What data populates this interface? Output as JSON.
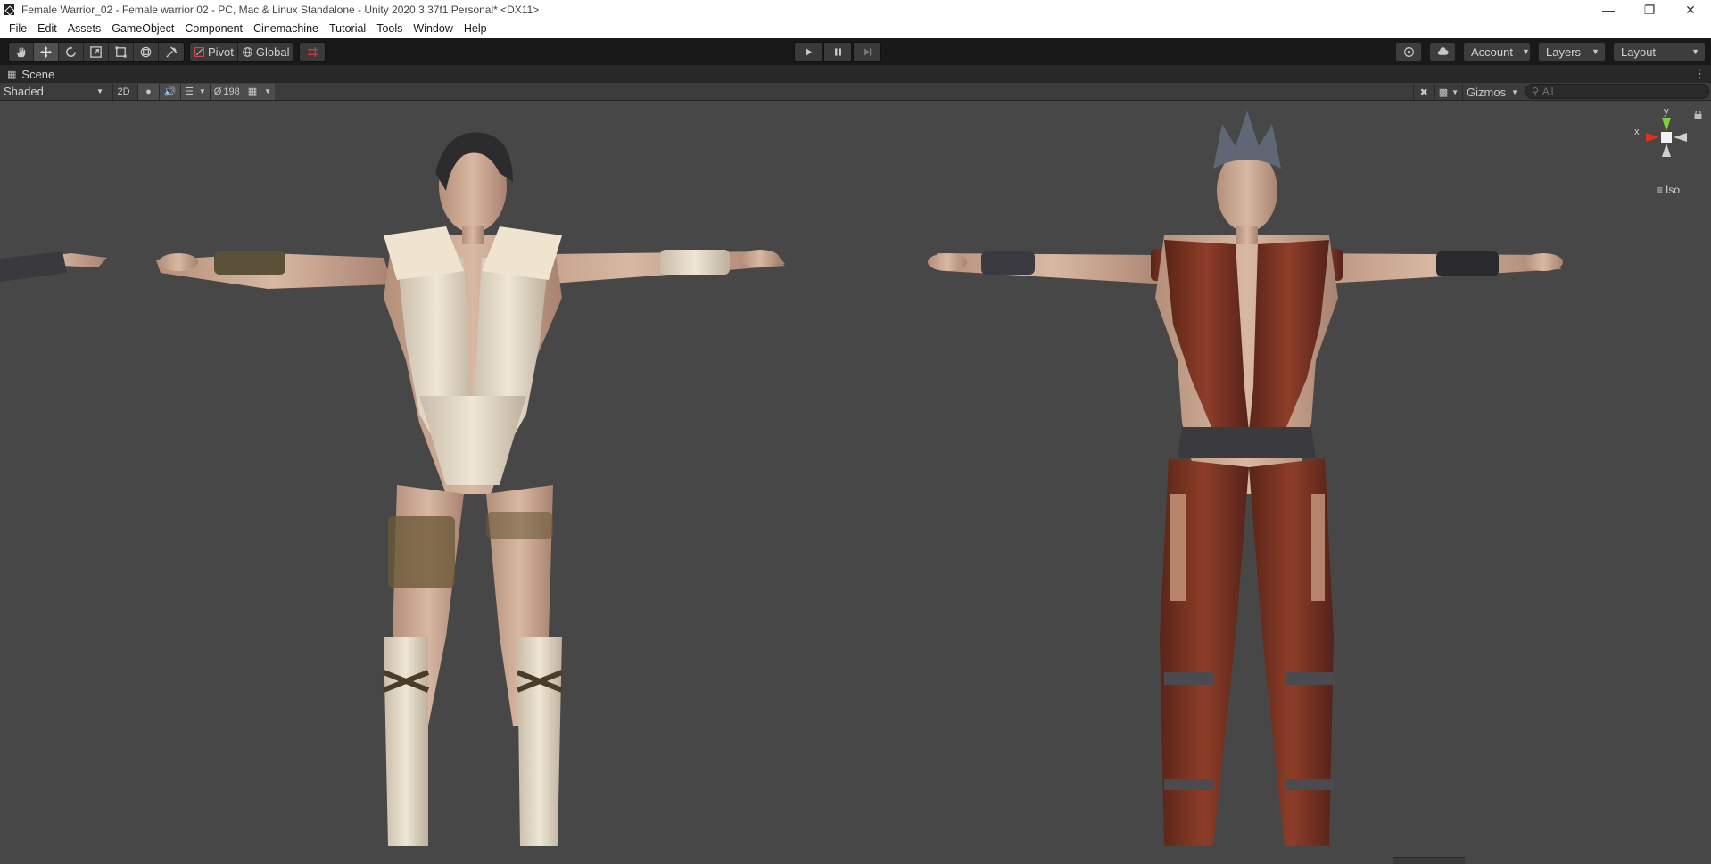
{
  "window": {
    "title": "Female Warrior_02 - Female warrior 02 - PC, Mac & Linux Standalone - Unity 2020.3.37f1 Personal* <DX11>",
    "controls": [
      "minimize-icon",
      "restore-icon",
      "close-icon"
    ]
  },
  "menu": [
    "File",
    "Edit",
    "Assets",
    "GameObject",
    "Component",
    "Cinemachine",
    "Tutorial",
    "Tools",
    "Window",
    "Help"
  ],
  "toolbar": {
    "tools": [
      "hand-icon",
      "move-icon",
      "rotate-icon",
      "scale-icon",
      "rect-icon",
      "transform-icon",
      "custom-tool-icon"
    ],
    "active_tool": "move-icon",
    "pivot_label": "Pivot",
    "global_label": "Global",
    "account_label": "Account",
    "layers_label": "Layers",
    "layout_label": "Layout"
  },
  "scene_tab": {
    "label": "Scene"
  },
  "scene_toolbar": {
    "shading_mode": "Shaded",
    "mode_2d": "2D",
    "hidden_count": "198",
    "gizmos_label": "Gizmos",
    "search_placeholder": "All"
  },
  "gizmo": {
    "y_label": "y",
    "x_label": "x",
    "projection": "Iso"
  },
  "colors": {
    "viewport_bg": "#474747",
    "toolbar_bg": "#191919",
    "gizmo_y": "#7bd33b",
    "gizmo_x": "#e0301e"
  }
}
